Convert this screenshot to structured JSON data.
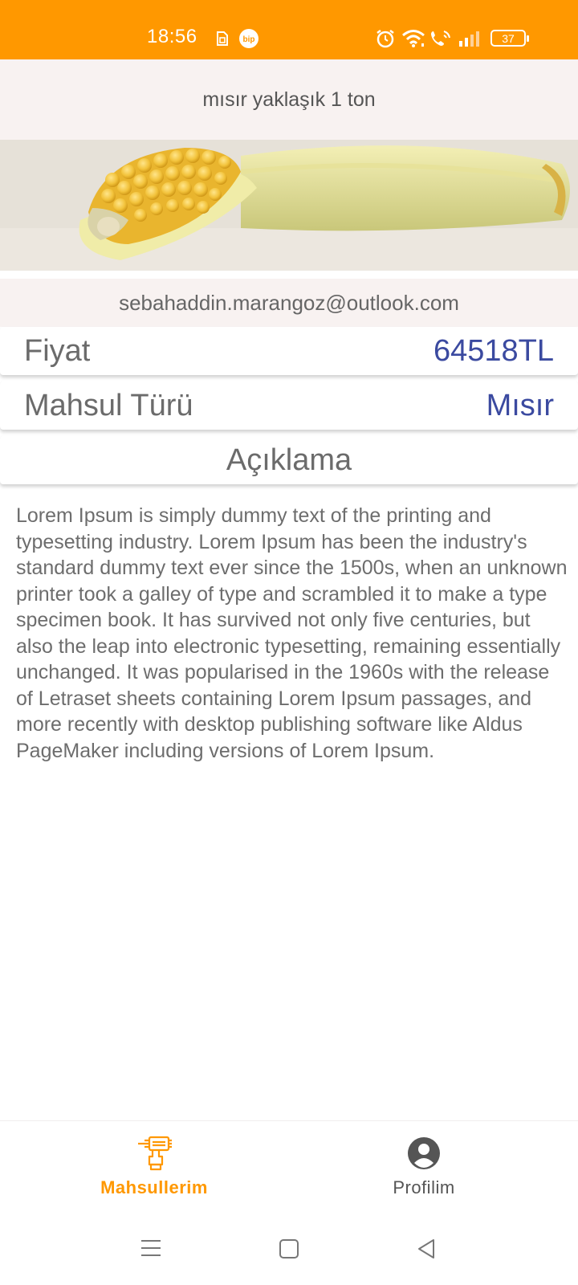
{
  "status_bar": {
    "time": "18:56",
    "battery": "37",
    "background_color": "#ff9800",
    "icons": [
      "sim-icon",
      "bip-icon",
      "alarm-icon",
      "wifi-icon",
      "volte-call-icon",
      "signal-icon",
      "battery-icon"
    ],
    "bip_label": "bip"
  },
  "header": {
    "title": "mısır yaklaşık 1 ton"
  },
  "product": {
    "email": "sebahaddin.marangoz@outlook.com",
    "price_label": "Fiyat",
    "price_value": "64518TL",
    "type_label": "Mahsul Türü",
    "type_value": "Mısır",
    "description_header": "Açıklama",
    "description": "Lorem Ipsum is simply dummy text of the printing and typesetting industry. Lorem Ipsum has been the industry's standard dummy text ever since the 1500s, when an unknown printer took a galley of type and scrambled it to make a type specimen book. It has survived not only five centuries, but also the leap into electronic typesetting, remaining essentially unchanged. It was popularised in the 1960s with the release of Letraset sheets containing Lorem Ipsum passages, and more recently with desktop publishing software like Aldus PageMaker including versions of Lorem Ipsum."
  },
  "bottom_nav": {
    "items": [
      {
        "label": "Mahsullerim",
        "icon": "crop-drill-icon",
        "active": true
      },
      {
        "label": "Profilim",
        "icon": "account-circle-icon",
        "active": false
      }
    ],
    "active_color": "#ff9800"
  },
  "system_nav": {
    "buttons": [
      "menu-icon",
      "home-icon",
      "back-icon"
    ]
  }
}
